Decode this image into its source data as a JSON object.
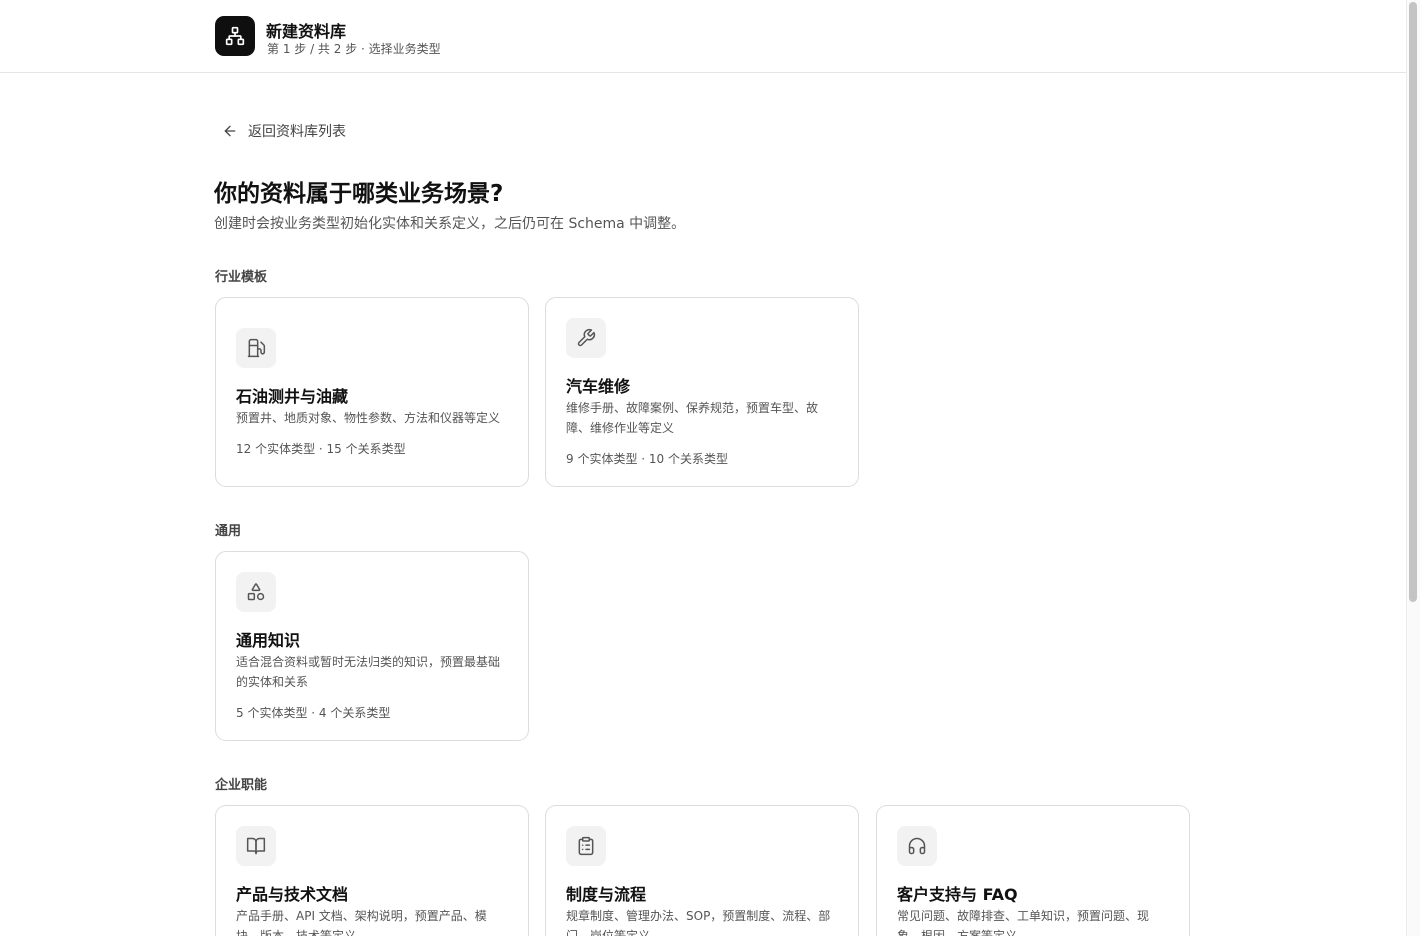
{
  "header": {
    "title": "新建资料库",
    "subtitle": "第 1 步 / 共 2 步 · 选择业务类型",
    "logo_icon": "sitemap-icon"
  },
  "back": {
    "label": "返回资料库列表",
    "icon": "arrow-left-icon"
  },
  "main": {
    "title": "你的资料属于哪类业务场景?",
    "description": "创建时会按业务类型初始化实体和关系定义，之后仍可在 Schema 中调整。"
  },
  "sections": [
    {
      "label": "行业模板",
      "cards": [
        {
          "icon": "fuel-pump-icon",
          "title": "石油测井与油藏",
          "description": "预置井、地质对象、物性参数、方法和仪器等定义",
          "meta": "12 个实体类型 · 15 个关系类型"
        },
        {
          "icon": "wrench-icon",
          "title": "汽车维修",
          "description": "维修手册、故障案例、保养规范，预置车型、故障、维修作业等定义",
          "meta": "9 个实体类型 · 10 个关系类型"
        }
      ]
    },
    {
      "label": "通用",
      "cards": [
        {
          "icon": "shapes-icon",
          "title": "通用知识",
          "description": "适合混合资料或暂时无法归类的知识，预置最基础的实体和关系",
          "meta": "5 个实体类型 · 4 个关系类型"
        }
      ]
    },
    {
      "label": "企业职能",
      "cards": [
        {
          "icon": "book-open-icon",
          "title": "产品与技术文档",
          "description": "产品手册、API 文档、架构说明，预置产品、模块、版本、技术等定义"
        },
        {
          "icon": "clipboard-list-icon",
          "title": "制度与流程",
          "description": "规章制度、管理办法、SOP，预置制度、流程、部门、岗位等定义"
        },
        {
          "icon": "headphones-icon",
          "title": "客户支持与 FAQ",
          "description": "常见问题、故障排查、工单知识，预置问题、现象、根因、方案等定义"
        }
      ]
    }
  ]
}
